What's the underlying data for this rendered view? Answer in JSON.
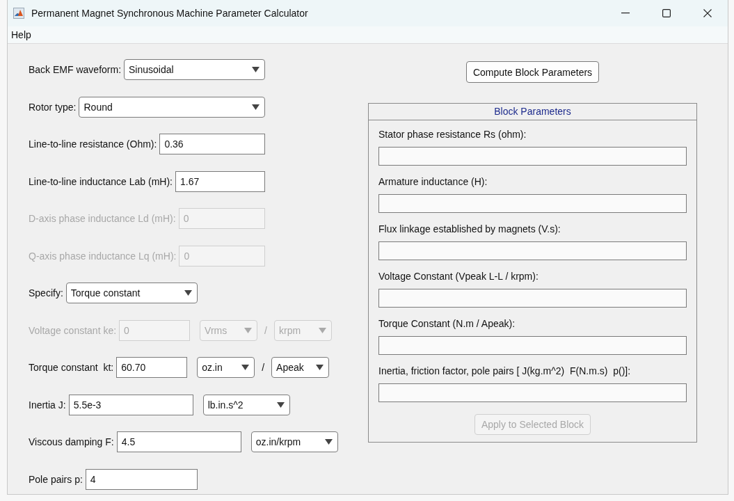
{
  "window": {
    "title": "Permanent Magnet Synchronous Machine Parameter Calculator"
  },
  "menu": [
    "Help"
  ],
  "left_rows": [
    {
      "kind": "dropdown",
      "label": "Back EMF waveform:",
      "value": "Sinusoidal",
      "disabled": false
    },
    {
      "kind": "dropdown",
      "label": "Rotor type:",
      "value": "Round",
      "disabled": false
    },
    {
      "kind": "text",
      "label": "Line-to-line resistance (Ohm):",
      "value": "0.36",
      "disabled": false
    },
    {
      "kind": "text",
      "label": "Line-to-line inductance Lab (mH):",
      "value": "1.67",
      "disabled": false
    },
    {
      "kind": "text",
      "label": "D-axis phase inductance Ld (mH):",
      "value": "0",
      "disabled": true
    },
    {
      "kind": "text",
      "label": "Q-axis phase inductance Lq (mH):",
      "value": "0",
      "disabled": true
    },
    {
      "kind": "dropdown",
      "label": "Specify:",
      "value": "Torque constant",
      "disabled": false
    },
    {
      "kind": "combo",
      "label": "Voltage constant ke:",
      "value": "0",
      "disabled": true,
      "units": [
        "Vrms",
        "krpm"
      ],
      "separator": "/"
    },
    {
      "kind": "combo",
      "label": "Torque constant  kt:",
      "value": "60.70",
      "disabled": false,
      "units": [
        "oz.in",
        "Apeak"
      ],
      "separator": "/"
    },
    {
      "kind": "combo",
      "label": "Inertia J:",
      "value": "5.5e-3",
      "disabled": false,
      "units": [
        "lb.in.s^2"
      ]
    },
    {
      "kind": "combo",
      "label": "Viscous damping F:",
      "value": "4.5",
      "disabled": false,
      "units": [
        "oz.in/krpm"
      ]
    },
    {
      "kind": "text",
      "label": "Pole pairs p:",
      "value": "4",
      "disabled": false
    }
  ],
  "compute_button": {
    "label": "Compute Block Parameters",
    "disabled": false
  },
  "block_parameters": {
    "title": "Block Parameters",
    "fields": [
      {
        "label": "Stator phase resistance Rs (ohm):"
      },
      {
        "label": "Armature inductance (H):"
      },
      {
        "label": "Flux linkage established by magnets (V.s):"
      },
      {
        "label": "Voltage Constant (Vpeak L-L / krpm):"
      },
      {
        "label": "Torque Constant (N.m / Apeak):"
      },
      {
        "label": "Inertia, friction factor, pole pairs [ J(kg.m^2)  F(N.m.s)  p()]:"
      }
    ]
  },
  "apply_button": {
    "label": "Apply to Selected Block",
    "disabled": true
  }
}
